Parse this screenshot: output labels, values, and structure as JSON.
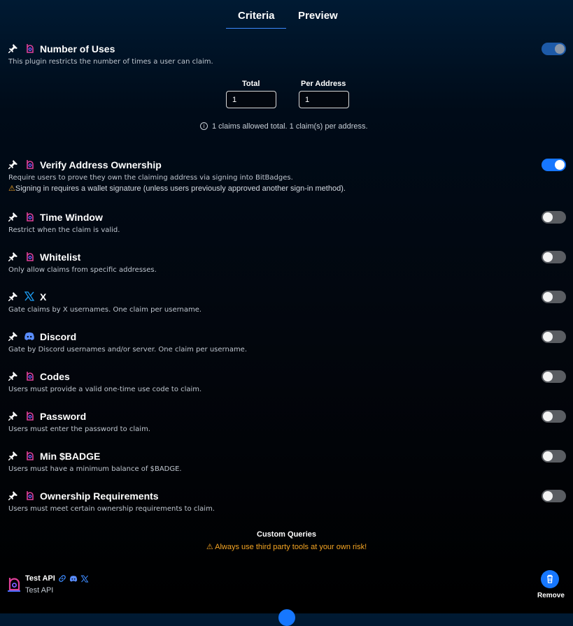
{
  "tabs": {
    "criteria": "Criteria",
    "preview": "Preview"
  },
  "colors": {
    "accent": "#1677ff",
    "warning": "#f5a623",
    "bitbadges_icon": "#e0409a"
  },
  "plugins": [
    {
      "title": "Number of Uses",
      "desc": "This plugin restricts the number of times a user can claim.",
      "icon": "bitbadges-icon",
      "enabled": true
    },
    {
      "title": "Verify Address Ownership",
      "desc": "Require users to prove they own the claiming address via signing into BitBadges.",
      "warning": "Signing in requires a wallet signature (unless users previously approved another sign-in method).",
      "icon": "bitbadges-icon",
      "enabled": true
    },
    {
      "title": "Time Window",
      "desc": "Restrict when the claim is valid.",
      "icon": "bitbadges-icon",
      "enabled": false
    },
    {
      "title": "Whitelist",
      "desc": "Only allow claims from specific addresses.",
      "icon": "bitbadges-icon",
      "enabled": false
    },
    {
      "title": "X",
      "desc": "Gate claims by X usernames. One claim per username.",
      "icon": "x-logo-icon",
      "enabled": false
    },
    {
      "title": "Discord",
      "desc": "Gate by Discord usernames and/or server. One claim per username.",
      "icon": "discord-icon",
      "enabled": false
    },
    {
      "title": "Codes",
      "desc": "Users must provide a valid one-time use code to claim.",
      "icon": "bitbadges-icon",
      "enabled": false
    },
    {
      "title": "Password",
      "desc": "Users must enter the password to claim.",
      "icon": "bitbadges-icon",
      "enabled": false
    },
    {
      "title": "Min $BADGE",
      "desc": "Users must have a minimum balance of $BADGE.",
      "icon": "bitbadges-icon",
      "enabled": false
    },
    {
      "title": "Ownership Requirements",
      "desc": "Users must meet certain ownership requirements to claim.",
      "icon": "bitbadges-icon",
      "enabled": false
    }
  ],
  "uses": {
    "total_label": "Total",
    "total_value": "1",
    "per_address_label": "Per Address",
    "per_address_value": "1",
    "info": "1 claims allowed total. 1 claim(s) per address."
  },
  "custom_queries": {
    "title": "Custom Queries",
    "warning": "Always use third party tools at your own risk!"
  },
  "api": {
    "title": "Test API",
    "subtitle": "Test API",
    "icons": [
      "link-icon",
      "discord-icon",
      "x-logo-icon"
    ],
    "remove_label": "Remove"
  }
}
